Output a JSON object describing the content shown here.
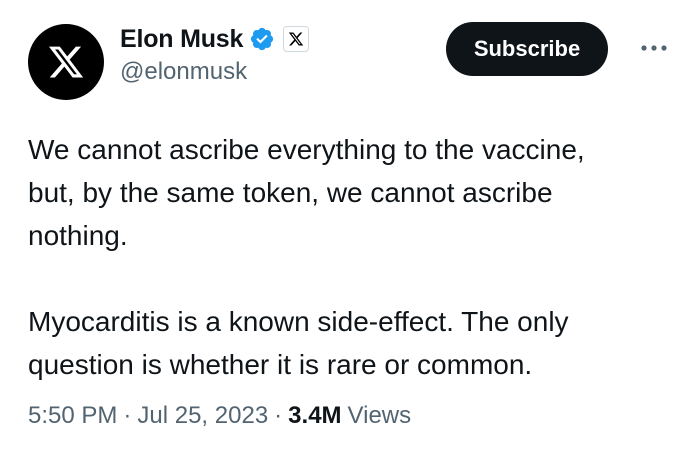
{
  "author": {
    "display_name": "Elon Musk",
    "handle": "@elonmusk",
    "avatar_icon": "x-logo-icon",
    "verified_icon": "verified-badge-icon",
    "affiliate_icon": "x-affiliate-badge-icon",
    "verified_color": "#1d9bf0"
  },
  "actions": {
    "subscribe_label": "Subscribe",
    "more_icon": "more-options-icon"
  },
  "tweet": {
    "paragraph_1": "We cannot ascribe everything to the vaccine,\nbut, by the same token, we cannot ascribe\nnothing.",
    "paragraph_2": "Myocarditis is a known side-effect. The only\nquestion is whether it is rare or common."
  },
  "meta": {
    "time": "5:50 PM",
    "date": "Jul 25, 2023",
    "separator": "·",
    "views_count": "3.4M",
    "views_label": "Views"
  }
}
